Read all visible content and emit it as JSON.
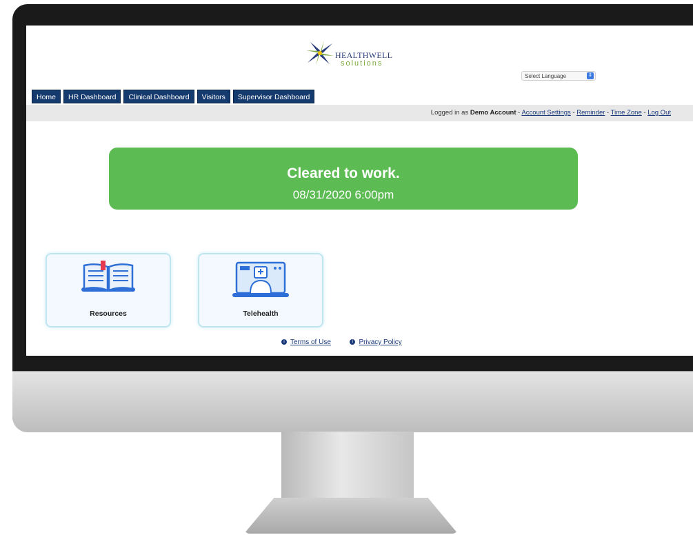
{
  "logo": {
    "brand_text": "HEALTHWELL",
    "sub_text": "solutions",
    "icon": "starburst-logo-icon"
  },
  "language": {
    "selected": "Select Language",
    "icon": "chevron-updown-icon"
  },
  "nav": {
    "items": [
      {
        "label": "Home"
      },
      {
        "label": "HR Dashboard"
      },
      {
        "label": "Clinical Dashboard"
      },
      {
        "label": "Visitors"
      },
      {
        "label": "Supervisor Dashboard"
      }
    ]
  },
  "account": {
    "prefix": "Logged in as ",
    "user": "Demo Account",
    "sep": " - ",
    "settings": "Account Settings",
    "reminder": "Reminder",
    "timezone": "Time Zone",
    "logout": "Log Out"
  },
  "banner": {
    "title": "Cleared to work.",
    "datetime": "08/31/2020 6:00pm",
    "color": "#5dbb53"
  },
  "tiles": [
    {
      "label": "Resources",
      "icon": "open-book-icon"
    },
    {
      "label": "Telehealth",
      "icon": "doctor-video-call-icon"
    }
  ],
  "footer": {
    "terms": "Terms of Use",
    "privacy": "Privacy Policy",
    "icon": "info-icon"
  },
  "colors": {
    "nav_bg": "#153a6e",
    "accent_blue": "#2d6fd6",
    "link": "#1a3a7a"
  }
}
